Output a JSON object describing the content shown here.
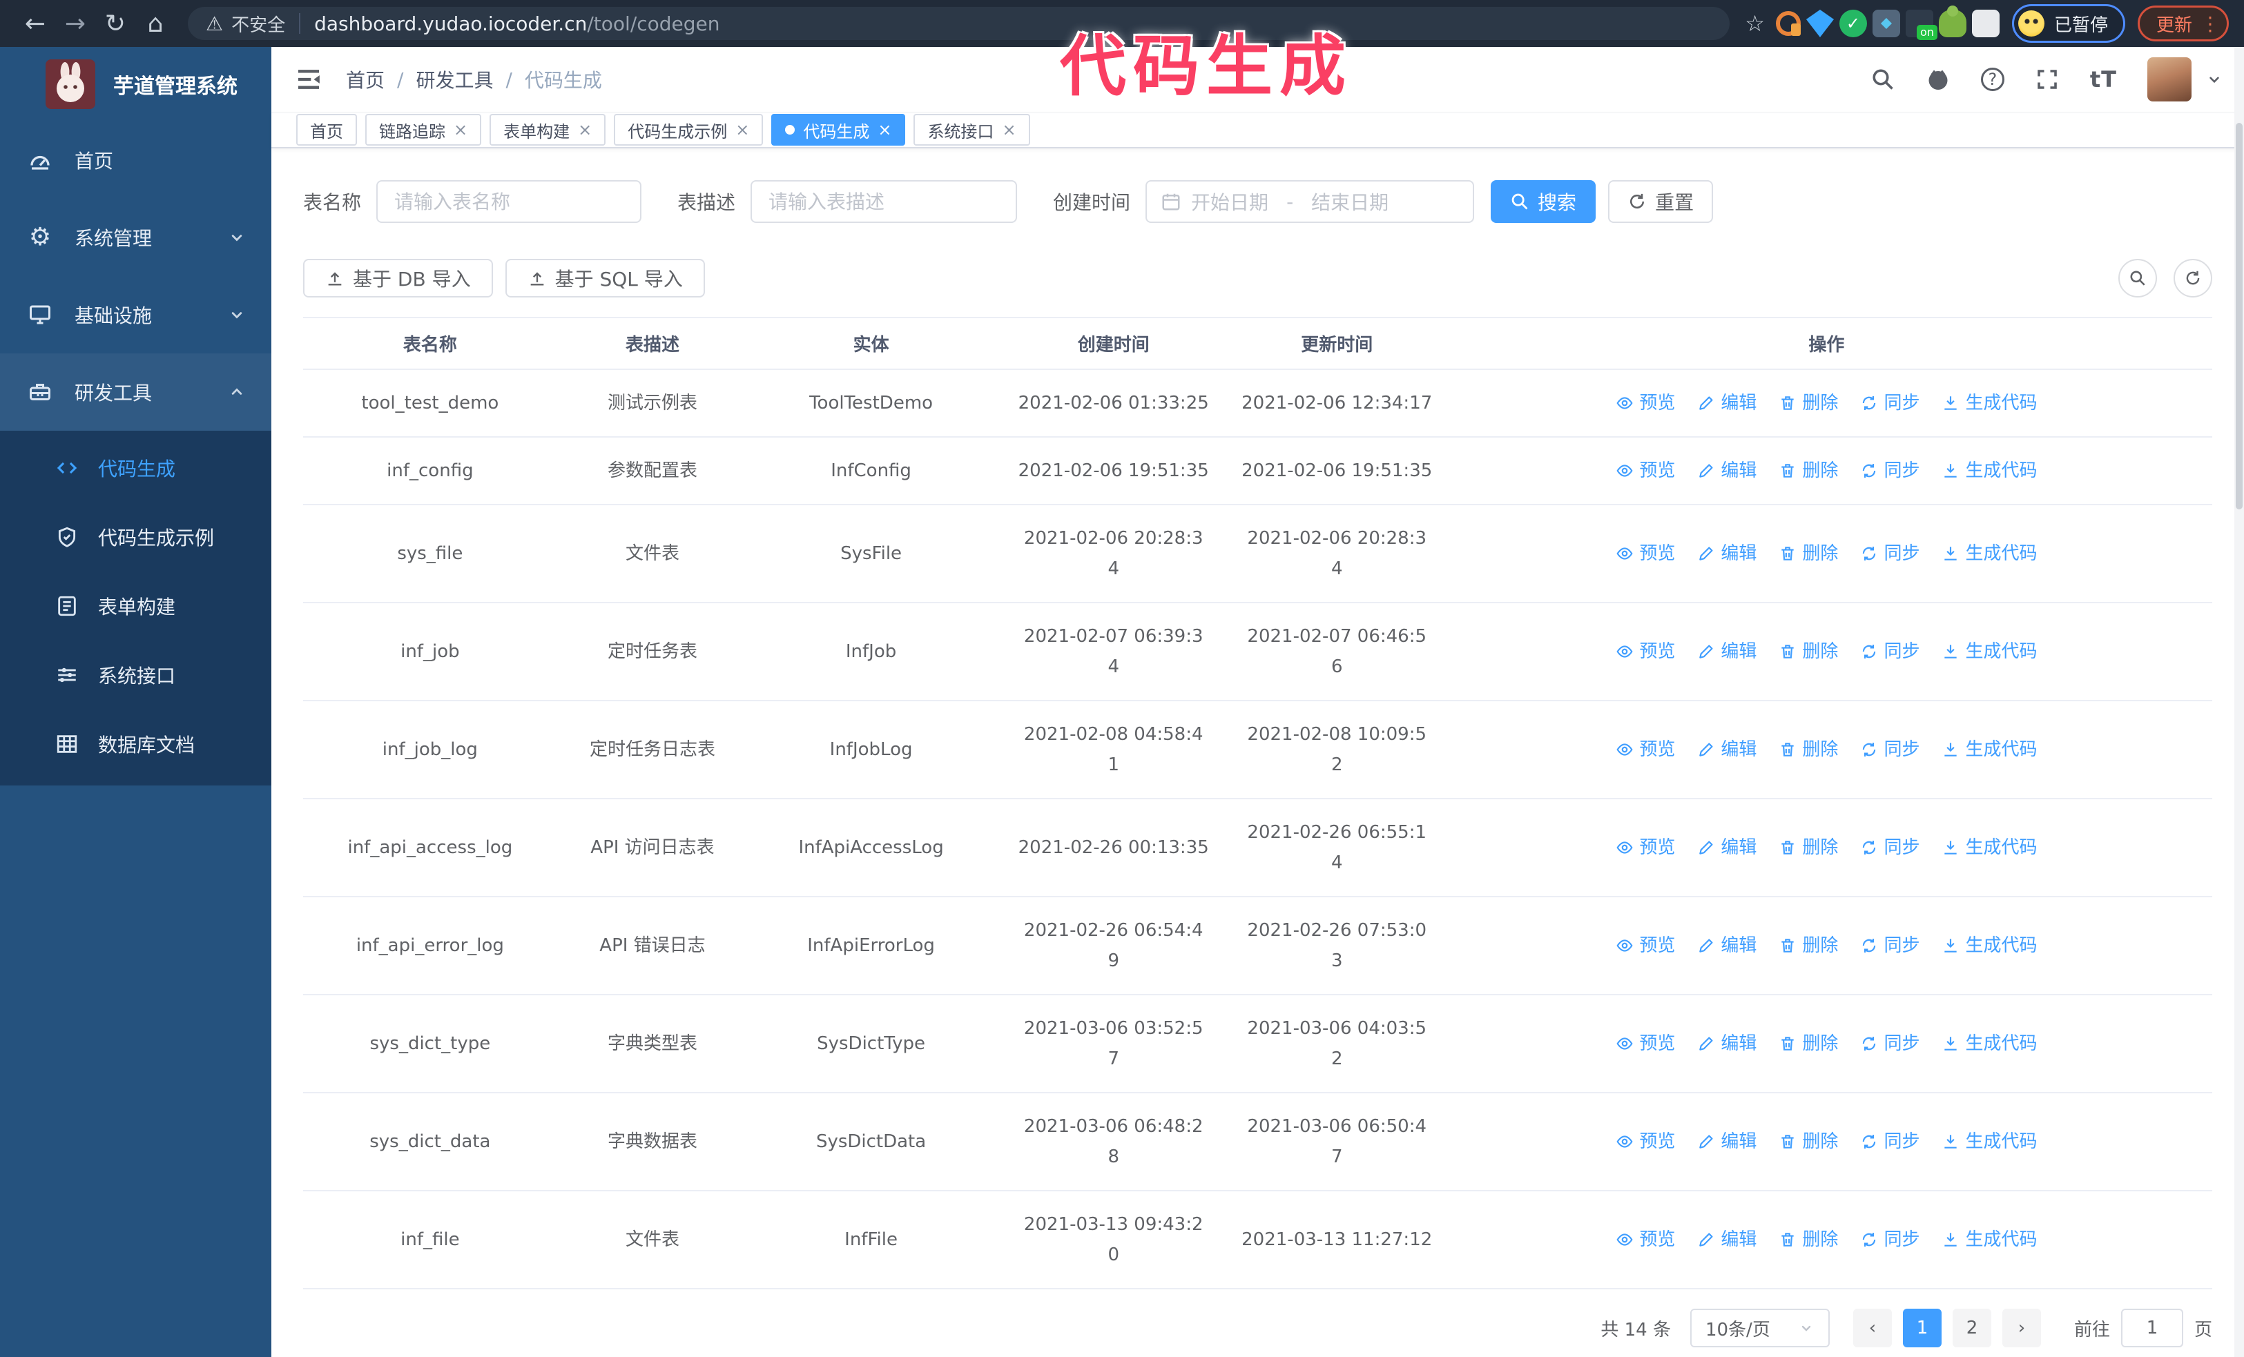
{
  "colors": {
    "accent": "#409eff",
    "annotation_pink": "#fa3f63",
    "sidebar_bg": "#25527e",
    "submenu_bg": "#1a3a5e",
    "chrome_bg": "#212b39",
    "active_menu_text": "#3ea2ff",
    "row_border": "#ebeef5"
  },
  "chrome": {
    "security_label": "不安全",
    "url_host": "dashboard.yudao.iocoder.cn",
    "url_path": "/tool/codegen",
    "extension_on_badge": "on",
    "extension_check": "✓",
    "profile_status": "已暂停",
    "update_label": "更新"
  },
  "annotation": {
    "text": "代码生成"
  },
  "sidebar": {
    "logo_title": "芋道管理系统",
    "items": [
      {
        "label": "首页",
        "icon": "dashboard-icon"
      },
      {
        "label": "系统管理",
        "icon": "gear-icon",
        "state": "collapsed"
      },
      {
        "label": "基础设施",
        "icon": "monitor-icon",
        "state": "collapsed"
      },
      {
        "label": "研发工具",
        "icon": "toolbox-icon",
        "state": "expanded"
      }
    ],
    "submenu": [
      {
        "label": "代码生成",
        "icon": "code-icon",
        "active": true
      },
      {
        "label": "代码生成示例",
        "icon": "shield-check-icon",
        "active": false
      },
      {
        "label": "表单构建",
        "icon": "form-icon",
        "active": false
      },
      {
        "label": "系统接口",
        "icon": "sliders-icon",
        "active": false
      },
      {
        "label": "数据库文档",
        "icon": "table-grid-icon",
        "active": false
      }
    ],
    "gear_glyph": "⚙"
  },
  "header": {
    "breadcrumb": [
      "首页",
      "研发工具",
      "代码生成"
    ],
    "breadcrumb_separator": "/",
    "font_size_icon_label": "tT"
  },
  "tabs": [
    {
      "label": "首页",
      "closable": false,
      "active": false
    },
    {
      "label": "链路追踪",
      "closable": true,
      "active": false
    },
    {
      "label": "表单构建",
      "closable": true,
      "active": false
    },
    {
      "label": "代码生成示例",
      "closable": true,
      "active": false
    },
    {
      "label": "代码生成",
      "closable": true,
      "active": true
    },
    {
      "label": "系统接口",
      "closable": true,
      "active": false
    }
  ],
  "filters": {
    "name_label": "表名称",
    "name_placeholder": "请输入表名称",
    "desc_label": "表描述",
    "desc_placeholder": "请输入表描述",
    "time_label": "创建时间",
    "start_placeholder": "开始日期",
    "range_separator": "-",
    "end_placeholder": "结束日期",
    "search_label": "搜索",
    "reset_label": "重置"
  },
  "toolbar": {
    "db_import_label": "基于 DB 导入",
    "sql_import_label": "基于 SQL 导入"
  },
  "table": {
    "columns": [
      "表名称",
      "表描述",
      "实体",
      "创建时间",
      "更新时间",
      "操作"
    ],
    "actions": [
      {
        "label": "预览",
        "icon": "eye"
      },
      {
        "label": "编辑",
        "icon": "edit"
      },
      {
        "label": "删除",
        "icon": "delete"
      },
      {
        "label": "同步",
        "icon": "sync"
      },
      {
        "label": "生成代码",
        "icon": "download"
      }
    ],
    "rows": [
      {
        "name": "tool_test_demo",
        "desc": "测试示例表",
        "entity": "ToolTestDemo",
        "created": "2021-02-06 01:33:25",
        "updated": "2021-02-06 12:34:17"
      },
      {
        "name": "inf_config",
        "desc": "参数配置表",
        "entity": "InfConfig",
        "created": "2021-02-06 19:51:35",
        "updated": "2021-02-06 19:51:35"
      },
      {
        "name": "sys_file",
        "desc": "文件表",
        "entity": "SysFile",
        "created": "2021-02-06 20:28:3\n4",
        "updated": "2021-02-06 20:28:3\n4"
      },
      {
        "name": "inf_job",
        "desc": "定时任务表",
        "entity": "InfJob",
        "created": "2021-02-07 06:39:3\n4",
        "updated": "2021-02-07 06:46:5\n6"
      },
      {
        "name": "inf_job_log",
        "desc": "定时任务日志表",
        "entity": "InfJobLog",
        "created": "2021-02-08 04:58:4\n1",
        "updated": "2021-02-08 10:09:5\n2"
      },
      {
        "name": "inf_api_access_log",
        "desc": "API 访问日志表",
        "entity": "InfApiAccessLog",
        "created": "2021-02-26 00:13:35",
        "updated": "2021-02-26 06:55:1\n4"
      },
      {
        "name": "inf_api_error_log",
        "desc": "API 错误日志",
        "entity": "InfApiErrorLog",
        "created": "2021-02-26 06:54:4\n9",
        "updated": "2021-02-26 07:53:0\n3"
      },
      {
        "name": "sys_dict_type",
        "desc": "字典类型表",
        "entity": "SysDictType",
        "created": "2021-03-06 03:52:5\n7",
        "updated": "2021-03-06 04:03:5\n2"
      },
      {
        "name": "sys_dict_data",
        "desc": "字典数据表",
        "entity": "SysDictData",
        "created": "2021-03-06 06:48:2\n8",
        "updated": "2021-03-06 06:50:4\n7"
      },
      {
        "name": "inf_file",
        "desc": "文件表",
        "entity": "InfFile",
        "created": "2021-03-13 09:43:2\n0",
        "updated": "2021-03-13 11:27:12"
      }
    ]
  },
  "pagination": {
    "total_label": "共 14 条",
    "page_size_label": "10条/页",
    "pages": [
      "1",
      "2"
    ],
    "active_page": "1",
    "goto_label": "前往",
    "goto_value": "1",
    "page_unit_label": "页"
  }
}
